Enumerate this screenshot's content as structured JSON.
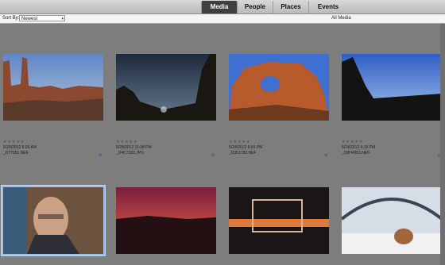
{
  "tabs": [
    {
      "label": "Media",
      "active": true
    },
    {
      "label": "People",
      "active": false
    },
    {
      "label": "Places",
      "active": false
    },
    {
      "label": "Events",
      "active": false
    }
  ],
  "toolbar": {
    "sort_label": "Sort By:",
    "sort_value": "Newest",
    "scope_label": "All Media"
  },
  "photos": [
    {
      "date": "5/29/2012 6:26 AM",
      "file": "_D77651.NEF",
      "rating": "★★★★★",
      "color": "sky-red-rock"
    },
    {
      "date": "5/28/2012 11:38 PM",
      "file": "_D4C7103.JPG",
      "rating": "★★★★★",
      "color": "night-sky"
    },
    {
      "date": "5/24/2012 6:59 PM",
      "file": "_D351782.NEF",
      "rating": "★★★★★",
      "color": "arch"
    },
    {
      "date": "5/24/2012 6:15 PM",
      "file": "_D8H4951.NEF",
      "rating": "★★★★★",
      "color": "dusk"
    }
  ],
  "bottom_photos": [
    "portrait",
    "sunset",
    "welcome-sign",
    "bridge-dog"
  ]
}
